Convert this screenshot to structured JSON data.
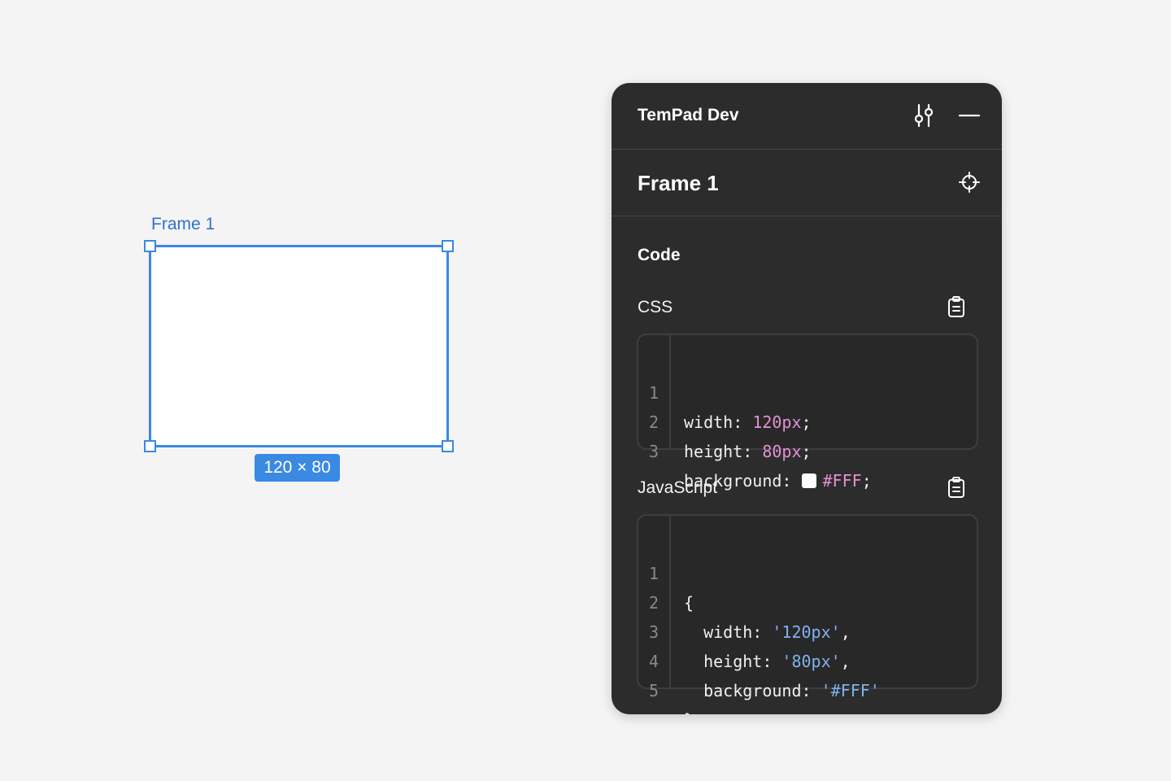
{
  "canvas": {
    "frame_label": "Frame 1",
    "size_badge": "120 × 80"
  },
  "panel": {
    "title": "TemPad Dev",
    "selection_name": "Frame 1",
    "section_title": "Code",
    "icons": {
      "settings": "sliders-icon",
      "minimize": "minus-icon",
      "target": "crosshair-icon",
      "copy": "clipboard-icon"
    },
    "css": {
      "label": "CSS",
      "lines": [
        {
          "num": "1",
          "key": "width",
          "sep": ": ",
          "value": "120px",
          "end": ";"
        },
        {
          "num": "2",
          "key": "height",
          "sep": ": ",
          "value": "80px",
          "end": ";"
        },
        {
          "num": "3",
          "key": "background",
          "sep": ": ",
          "value": "#FFF",
          "end": ";"
        }
      ]
    },
    "js": {
      "label": "JavaScript",
      "lines": [
        {
          "num": "1",
          "text": "{"
        },
        {
          "num": "2",
          "key": "  width",
          "sep": ": ",
          "value": "'120px'",
          "end": ","
        },
        {
          "num": "3",
          "key": "  height",
          "sep": ": ",
          "value": "'80px'",
          "end": ","
        },
        {
          "num": "4",
          "key": "  background",
          "sep": ": ",
          "value": "'#FFF'",
          "end": ""
        },
        {
          "num": "5",
          "text": "}"
        }
      ]
    }
  },
  "colors": {
    "selection_blue": "#3a89e2",
    "panel_bg": "#2c2c2c",
    "css_value": "#e58fd0",
    "js_string": "#7fb2f0"
  }
}
